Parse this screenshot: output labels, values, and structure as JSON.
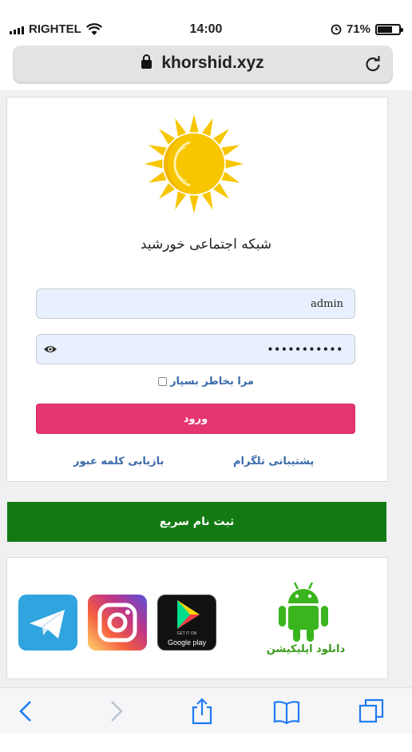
{
  "status_bar": {
    "carrier": "RIGHTEL",
    "time": "14:00",
    "battery": "71%",
    "battery_level": 0.71
  },
  "browser": {
    "url": "khorshid.xyz"
  },
  "site": {
    "title": "شبکه اجتماعی خورشید"
  },
  "login": {
    "username_value": "admin",
    "password_dots": "•••••••••••",
    "remember_label": "مرا بخاطر بسپار",
    "login_label": "ورود",
    "support_link": "پشتیبانی تلگرام",
    "recover_link": "بازیابی کلمه عبور"
  },
  "signup": {
    "label": "ثبت نام سریع"
  },
  "apps": {
    "download_label": "دانلود اپلیکیشن",
    "google_play_small": "GET IT ON",
    "google_play_label": "Google play"
  },
  "colors": {
    "login_button": "#e63573",
    "signup_button": "#137a13",
    "sun": "#f7c600",
    "android": "#3ab51e"
  },
  "icons": [
    "signal-icon",
    "wifi-icon",
    "lock-icon",
    "reload-icon",
    "alarm-icon",
    "battery-icon",
    "sun-logo-icon",
    "eye-icon",
    "telegram-icon",
    "instagram-icon",
    "google-play-icon",
    "android-icon",
    "back-icon",
    "forward-icon",
    "share-icon",
    "bookmarks-icon",
    "tabs-icon"
  ]
}
